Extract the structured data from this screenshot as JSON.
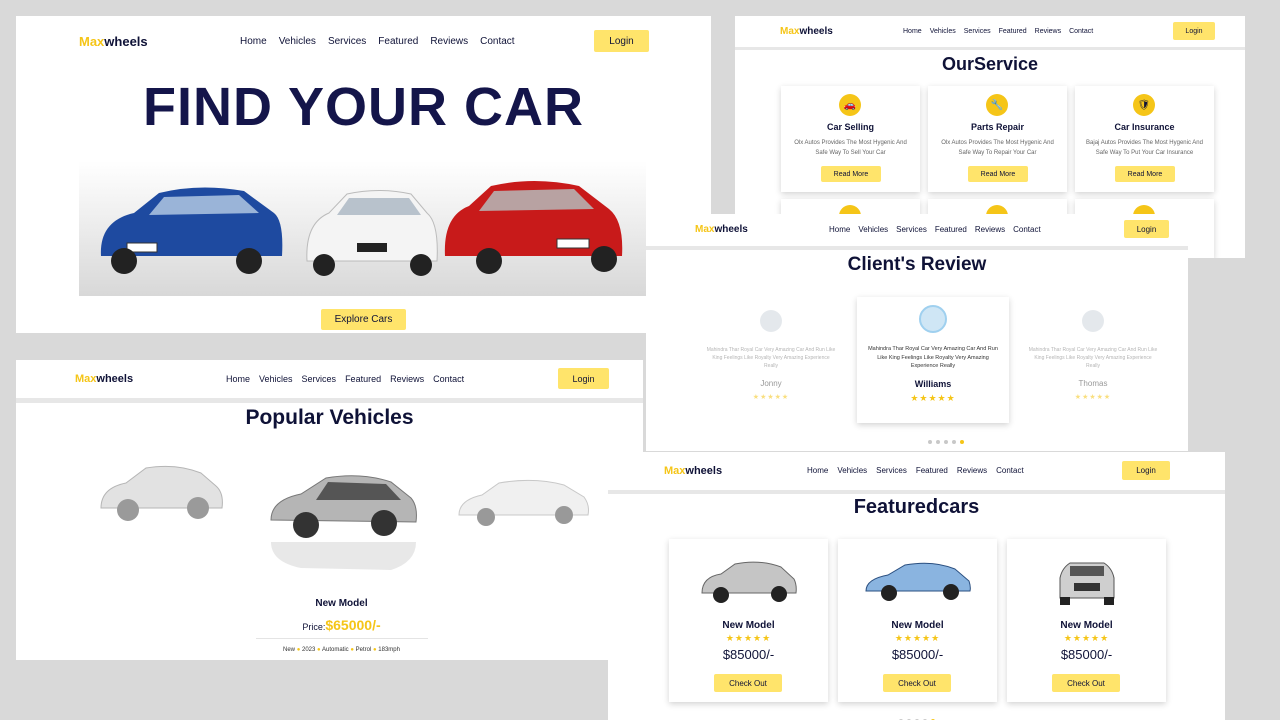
{
  "brand": {
    "prefix": "Max",
    "suffix": "wheels"
  },
  "nav": {
    "links": [
      "Home",
      "Vehicles",
      "Services",
      "Featured",
      "Reviews",
      "Contact"
    ],
    "login": "Login"
  },
  "hero": {
    "headline": "FIND YOUR CAR",
    "cta": "Explore Cars"
  },
  "services": {
    "title_a": "Our",
    "title_b": "Service",
    "cards": [
      {
        "title": "Car Selling",
        "text": "Olx Autos Provides The Most Hygenic And Safe Way To Sell Your Car",
        "button": "Read More",
        "icon": "car-icon"
      },
      {
        "title": "Parts Repair",
        "text": "Olx Autos Provides The Most Hygenic And Safe Way To Repair Your Car",
        "button": "Read More",
        "icon": "wrench-icon"
      },
      {
        "title": "Car Insurance",
        "text": "Bajaj Autos Provides The Most Hygenic And Safe Way To Put Your Car Insurance",
        "button": "Read More",
        "icon": "insurance-icon"
      }
    ]
  },
  "popular": {
    "title_a": "Popular ",
    "title_b": "Vehicles",
    "model": "New Model",
    "price_label": "Price:",
    "price": "$65000/-",
    "specs": [
      "New",
      "2023",
      "Automatic",
      "Petrol",
      "183mph"
    ]
  },
  "reviews": {
    "title_a": "Client's ",
    "title_b": "Review",
    "items": [
      {
        "name": "Jonny",
        "text": "Mahindra Thar Royal Car Very Amazing Car And Run Like King Feelings Like Royalty Very Amazing Experience Really",
        "stars": "★★★★★"
      },
      {
        "name": "Williams",
        "text": "Mahindra Thar Royal Car Very Amazing Car And Run Like King Feelings Like Royalty Very Amazing Experience Really",
        "stars": "★★★★★"
      },
      {
        "name": "Thomas",
        "text": "Mahindra Thar Royal Car Very Amazing Car And Run Like King Feelings Like Royalty Very Amazing Experience Really",
        "stars": "★★★★★"
      }
    ]
  },
  "featured": {
    "title_a": "Featured",
    "title_b": "cars",
    "cards": [
      {
        "model": "New Model",
        "price": "$85000/-",
        "button": "Check Out",
        "stars": "★★★★★"
      },
      {
        "model": "New Model",
        "price": "$85000/-",
        "button": "Check Out",
        "stars": "★★★★★"
      },
      {
        "model": "New Model",
        "price": "$85000/-",
        "button": "Check Out",
        "stars": "★★★★★"
      }
    ]
  },
  "colors": {
    "accent": "#ffe46b",
    "brand_yellow": "#f5c518",
    "navy": "#0f1237"
  }
}
